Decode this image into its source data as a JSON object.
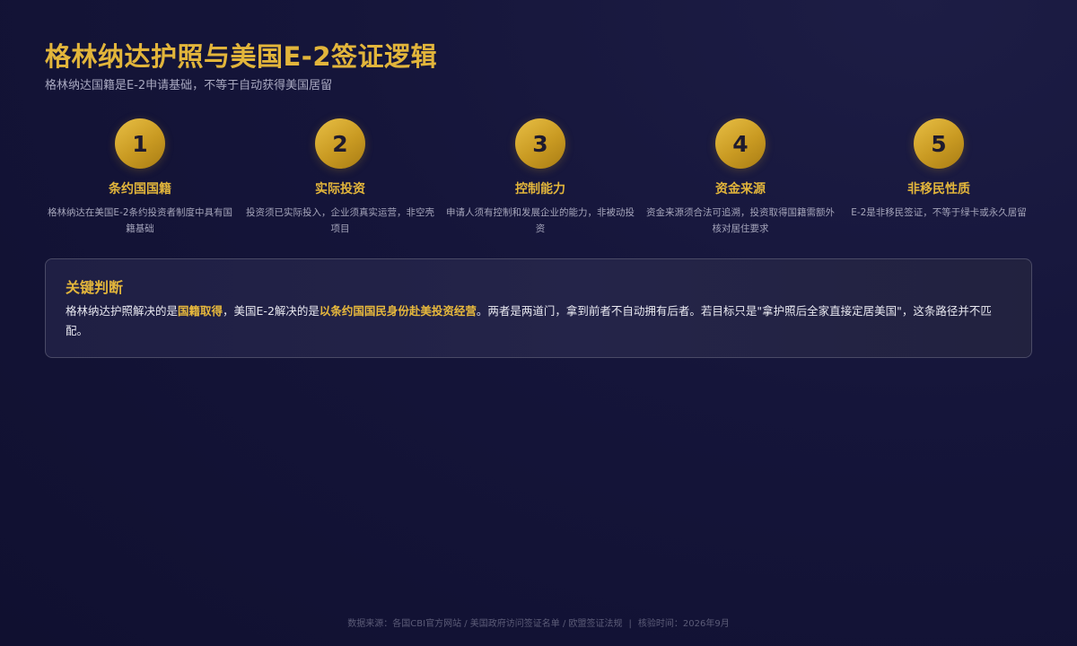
{
  "header": {
    "title": "格林纳达护照与美国E-2签证逻辑",
    "subtitle": "格林纳达国籍是E-2申请基础，不等于自动获得美国居留"
  },
  "steps": [
    {
      "number": "1",
      "title": "条约国国籍",
      "desc": "格林纳达在美国E-2条约投资者制度中具有国籍基础"
    },
    {
      "number": "2",
      "title": "实际投资",
      "desc": "投资须已实际投入，企业须真实运营，非空壳项目"
    },
    {
      "number": "3",
      "title": "控制能力",
      "desc": "申请人须有控制和发展企业的能力，非被动投资"
    },
    {
      "number": "4",
      "title": "资金来源",
      "desc": "资金来源须合法可追溯，投资取得国籍需额外核对居住要求"
    },
    {
      "number": "5",
      "title": "非移民性质",
      "desc": "E-2是非移民签证，不等于绿卡或永久居留"
    }
  ],
  "conclusion": {
    "title": "关键判断",
    "text_parts": [
      "格林纳达护照解决的是",
      "国籍取得",
      "，美国E-2解决的是",
      "以条约国国民身份赴美投资经营",
      "。两者是两道门，拿到前者不自动拥有后者。若目标只是\"拿护照后全家直接定居美国\"，这条路径并不匹配。"
    ]
  },
  "footer": {
    "sources": "数据来源：各国CBI官方网站 / 美国政府访问签证名单 / 欧盟签证法规",
    "separator": "|",
    "verified": "核验时间：2026年9月"
  },
  "colors": {
    "accent_gold": "#e2b53b",
    "background": "#15153a",
    "box_border": "#4a4a66"
  }
}
